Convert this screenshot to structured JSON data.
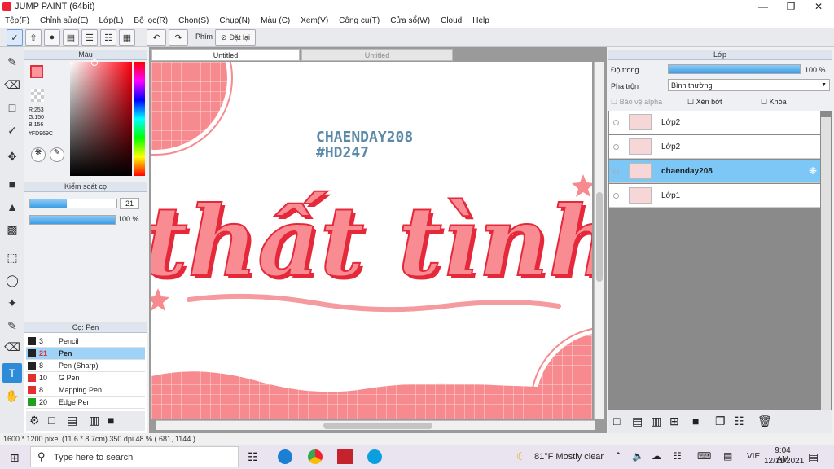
{
  "window": {
    "title": "JUMP PAINT (64bit)"
  },
  "menu": [
    "Tệp(F)",
    "Chỉnh sửa(E)",
    "Lớp(L)",
    "Bộ lọc(R)",
    "Chọn(S)",
    "Chụp(N)",
    "Màu (C)",
    "Xem(V)",
    "Công cụ(T)",
    "Cửa sổ(W)",
    "Cloud",
    "Help"
  ],
  "toolbar": {
    "key_label": "Phím",
    "reset_label": "Đặt lại"
  },
  "color_panel": {
    "title": "Màu",
    "r": "R:253",
    "g": "G:150",
    "b": "B:156",
    "hex": "#FD969C",
    "accent": "#FD969C"
  },
  "brush_control": {
    "title": "Kiểm soát cọ",
    "size": "21",
    "opacity": "100 %",
    "size_fraction": 0.42,
    "opacity_fraction": 1.0
  },
  "brush_panel": {
    "title": "Cọ: Pen",
    "items": [
      {
        "size": "3",
        "name": "Pencil",
        "color": "#222222"
      },
      {
        "size": "21",
        "name": "Pen",
        "color": "#222222"
      },
      {
        "size": "8",
        "name": "Pen (Sharp)",
        "color": "#222222"
      },
      {
        "size": "10",
        "name": "G Pen",
        "color": "#e03030"
      },
      {
        "size": "8",
        "name": "Mapping Pen",
        "color": "#e03030"
      },
      {
        "size": "20",
        "name": "Edge Pen",
        "color": "#20a020"
      }
    ]
  },
  "tabs": [
    "Untitled",
    "Untitled"
  ],
  "artwork": {
    "line1": "CHAENDAY208",
    "line2": "#HD247",
    "main_text": "thất tình"
  },
  "layer_panel": {
    "title": "Lớp",
    "opacity_label": "Độ trong",
    "opacity_value": "100 %",
    "blend_label": "Pha trộn",
    "blend_value": "Bình thường",
    "protect_alpha": "Bảo vệ alpha",
    "clip": "Xén bớt",
    "lock": "Khóa",
    "layers": [
      {
        "name": "Lớp2"
      },
      {
        "name": "Lớp2"
      },
      {
        "name": "chaenday208"
      },
      {
        "name": "Lớp1"
      }
    ]
  },
  "status": {
    "text": "1600 * 1200 pixel  (11.6 * 8.7cm)  350 dpi  48 %  ( 681, 1144 )"
  },
  "taskbar": {
    "search_placeholder": "Type here to search",
    "weather": "81°F  Mostly clear",
    "lang": "VIE",
    "time": "9:04 AM",
    "date": "12/11/2021"
  }
}
